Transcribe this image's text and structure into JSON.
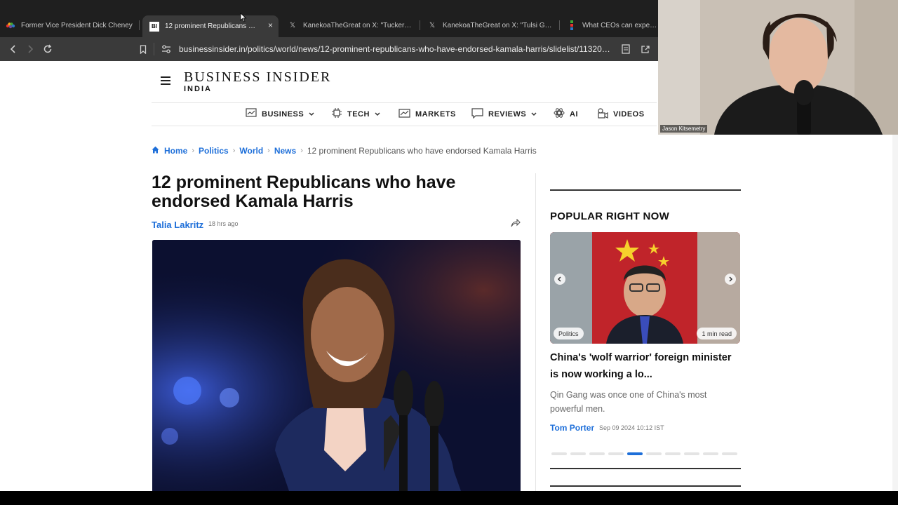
{
  "browser": {
    "tabs": [
      {
        "title": "Former Vice President Dick Cheney",
        "favicon": "nbc-peacock-icon",
        "active": false
      },
      {
        "title": "12 prominent Republicans who",
        "favicon": "business-insider-icon",
        "favicon_text": "BI",
        "active": true
      },
      {
        "title": "KanekoaTheGreat on X: \"Tucker Car",
        "favicon": "x-icon",
        "favicon_text": "𝕏",
        "active": false
      },
      {
        "title": "KanekoaTheGreat on X: \"Tulsi Gabba",
        "favicon": "x-icon",
        "favicon_text": "𝕏",
        "active": false
      },
      {
        "title": "What CEOs can expect fr",
        "favicon": "generic-site-icon",
        "active": false
      }
    ],
    "close_glyph": "×",
    "url": "businessinsider.in/politics/world/news/12-prominent-republicans-who-have-endorsed-kamala-harris/slidelist/11320525..."
  },
  "site": {
    "logo_main": "BUSINESS INSIDER",
    "logo_sub": "INDIA",
    "nav": [
      {
        "label": "BUSINESS",
        "icon": "chart-icon",
        "dropdown": true
      },
      {
        "label": "TECH",
        "icon": "chip-icon",
        "dropdown": true
      },
      {
        "label": "MARKETS",
        "icon": "trend-icon",
        "dropdown": false
      },
      {
        "label": "REVIEWS",
        "icon": "comment-icon",
        "dropdown": true
      },
      {
        "label": "AI",
        "icon": "ai-icon",
        "dropdown": false
      },
      {
        "label": "VIDEOS",
        "icon": "video-icon",
        "dropdown": false
      }
    ]
  },
  "breadcrumb": {
    "items": [
      "Home",
      "Politics",
      "World",
      "News"
    ],
    "current": "12 prominent Republicans who have endorsed Kamala Harris"
  },
  "article": {
    "headline": "12 prominent Republicans who have endorsed Kamala Harris",
    "author": "Talia Lakritz",
    "time_ago": "18 hrs ago"
  },
  "sidebar": {
    "section_title": "POPULAR RIGHT NOW",
    "card": {
      "category": "Politics",
      "read_time": "1 min read",
      "title": "China's 'wolf warrior' foreign minister is now working a lo...",
      "description": "Qin Gang was once one of China's most powerful men.",
      "author": "Tom Porter",
      "date": "Sep 09 2024 10:12 IST"
    },
    "carousel": {
      "count": 10,
      "active_index": 4
    }
  },
  "webcam": {
    "name": "Jason Kitsemetry"
  },
  "colors": {
    "accent": "#1e6fd9",
    "tabbar": "#1f1f1f",
    "toolbar": "#3a3a3a"
  }
}
